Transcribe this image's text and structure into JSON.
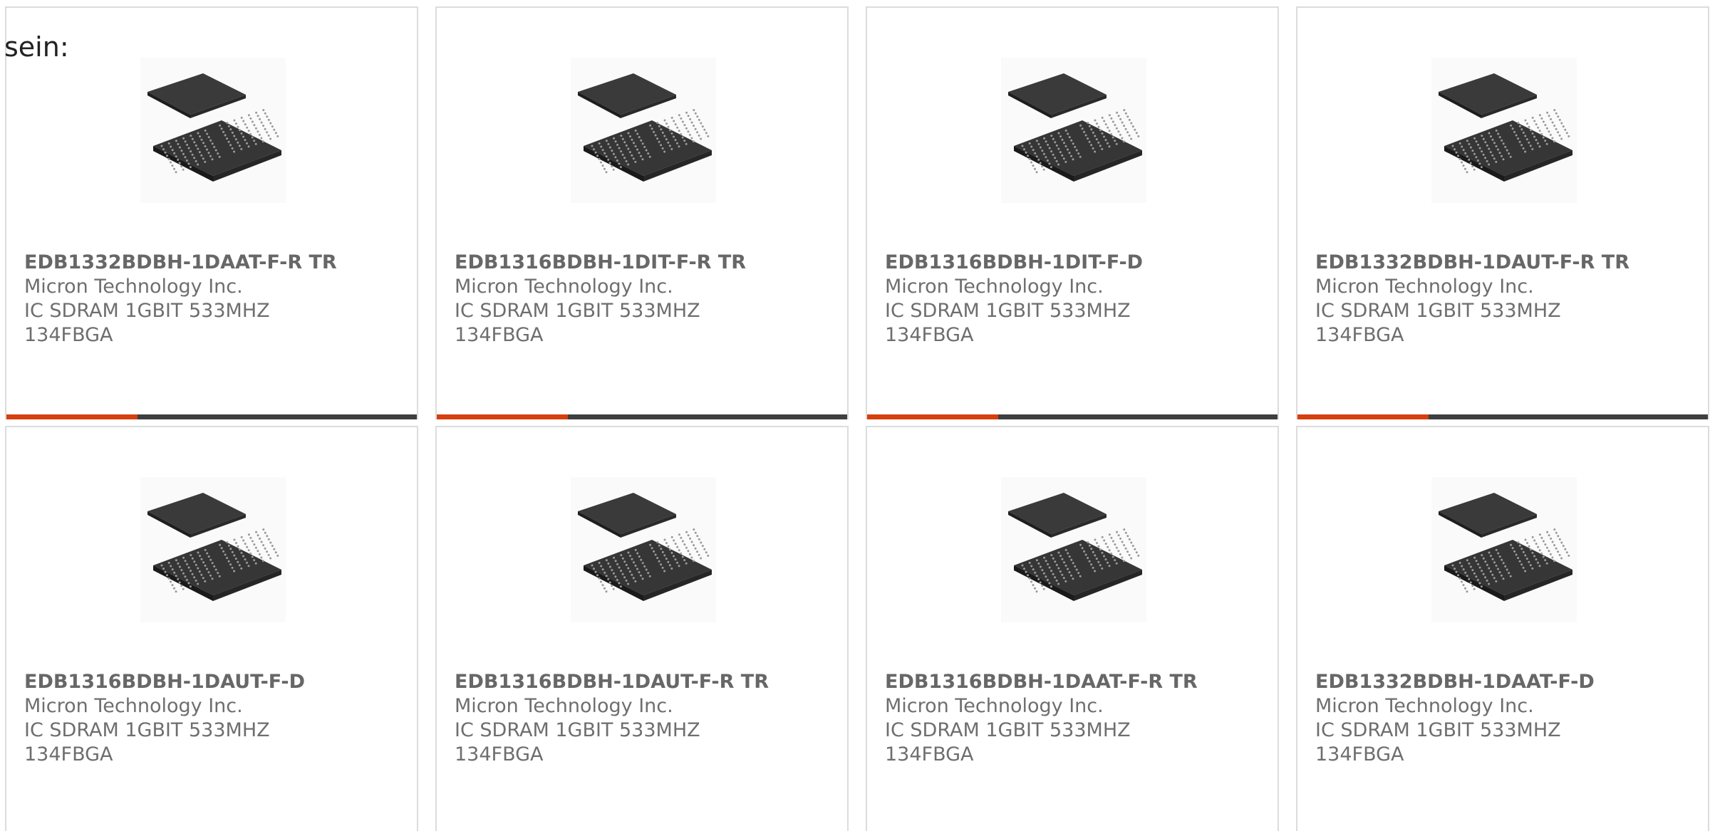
{
  "intro_text": "sein:",
  "colors": {
    "accent": "#d6400f",
    "bar": "#3f3f3f",
    "text": "#6e6e6e",
    "border": "#dcdcdc"
  },
  "products": [
    {
      "part_number": "EDB1332BDBH-1DAAT-F-R TR",
      "manufacturer": "Micron Technology Inc.",
      "description_line1": "IC SDRAM 1GBIT 533MHZ",
      "description_line2": "134FBGA",
      "image_icon": "bga-chip-icon",
      "accent_progress": 0.32
    },
    {
      "part_number": "EDB1316BDBH-1DIT-F-R TR",
      "manufacturer": "Micron Technology Inc.",
      "description_line1": "IC SDRAM 1GBIT 533MHZ",
      "description_line2": "134FBGA",
      "image_icon": "bga-chip-icon",
      "accent_progress": 0.32
    },
    {
      "part_number": "EDB1316BDBH-1DIT-F-D",
      "manufacturer": "Micron Technology Inc.",
      "description_line1": "IC SDRAM 1GBIT 533MHZ",
      "description_line2": "134FBGA",
      "image_icon": "bga-chip-icon",
      "accent_progress": 0.32
    },
    {
      "part_number": "EDB1332BDBH-1DAUT-F-R TR",
      "manufacturer": "Micron Technology Inc.",
      "description_line1": "IC SDRAM 1GBIT 533MHZ",
      "description_line2": "134FBGA",
      "image_icon": "bga-chip-icon",
      "accent_progress": 0.32
    },
    {
      "part_number": "EDB1316BDBH-1DAUT-F-D",
      "manufacturer": "Micron Technology Inc.",
      "description_line1": "IC SDRAM 1GBIT 533MHZ",
      "description_line2": "134FBGA",
      "image_icon": "bga-chip-icon",
      "accent_progress": 0.32
    },
    {
      "part_number": "EDB1316BDBH-1DAUT-F-R TR",
      "manufacturer": "Micron Technology Inc.",
      "description_line1": "IC SDRAM 1GBIT 533MHZ",
      "description_line2": "134FBGA",
      "image_icon": "bga-chip-icon",
      "accent_progress": 0.32
    },
    {
      "part_number": "EDB1316BDBH-1DAAT-F-R TR",
      "manufacturer": "Micron Technology Inc.",
      "description_line1": "IC SDRAM 1GBIT 533MHZ",
      "description_line2": "134FBGA",
      "image_icon": "bga-chip-icon",
      "accent_progress": 0.32
    },
    {
      "part_number": "EDB1332BDBH-1DAAT-F-D",
      "manufacturer": "Micron Technology Inc.",
      "description_line1": "IC SDRAM 1GBIT 533MHZ",
      "description_line2": "134FBGA",
      "image_icon": "bga-chip-icon",
      "accent_progress": 0.32
    }
  ]
}
